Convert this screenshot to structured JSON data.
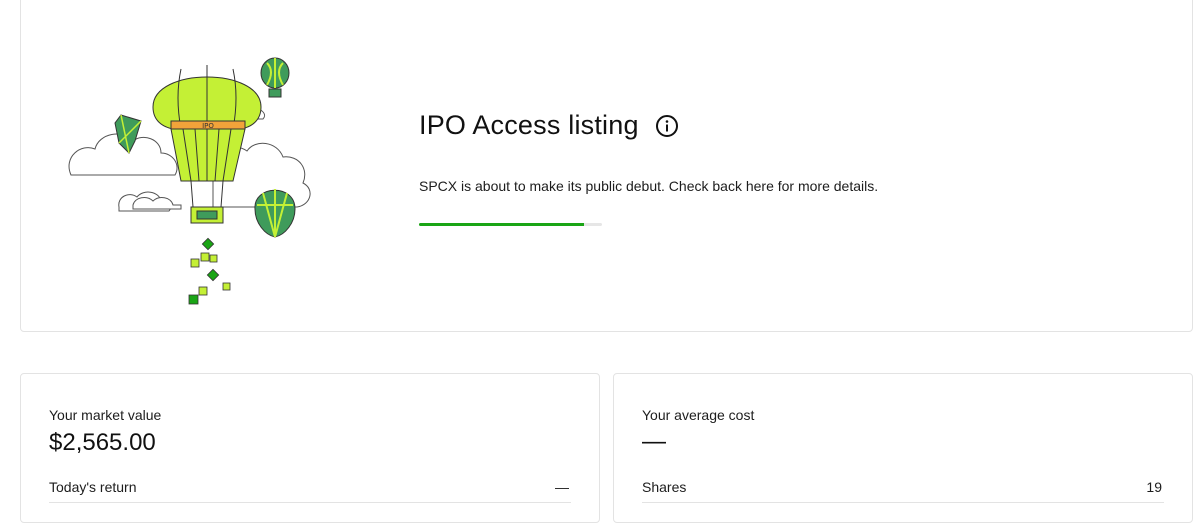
{
  "ipo": {
    "title": "IPO Access listing",
    "description": "SPCX is about to make its public debut. Check back here for more details.",
    "progress_percent": 90,
    "balloon_text": "IPO"
  },
  "market": {
    "label": "Your market value",
    "value": "$2,565.00",
    "today_return_label": "Today's return",
    "today_return_value": "—"
  },
  "average": {
    "label": "Your average cost",
    "value": "—",
    "shares_label": "Shares",
    "shares_value": "19"
  },
  "colors": {
    "accent": "#1aa515",
    "balloon_lime": "#c4f035",
    "balloon_green": "#3f9b5b",
    "balloon_orange": "#f2a33a"
  },
  "icons": {
    "info": "info-icon"
  }
}
